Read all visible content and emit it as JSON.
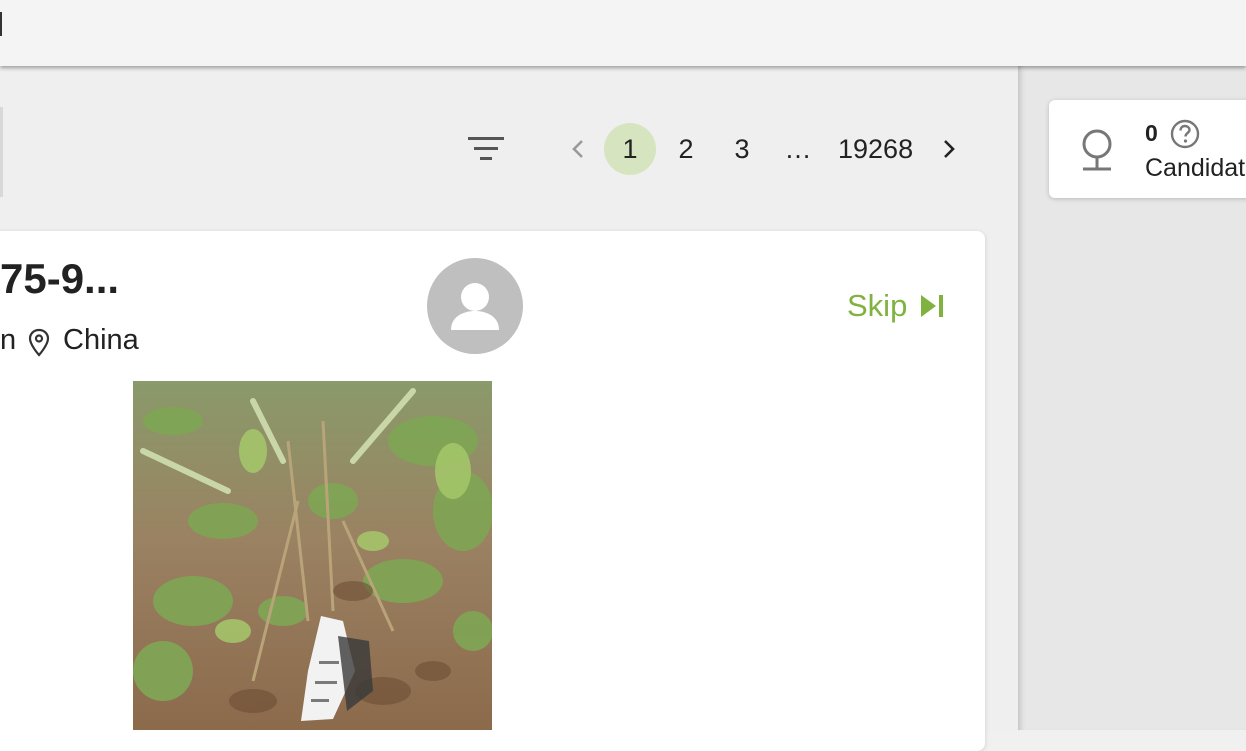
{
  "pagination": {
    "prev_icon": "chevron-left-icon",
    "next_icon": "chevron-right-icon",
    "pages": [
      "1",
      "2",
      "3",
      "…",
      "19268"
    ],
    "current": "1"
  },
  "filter": {
    "icon": "filter-icon"
  },
  "observation": {
    "title": "75-9...",
    "meta_prefix": "n",
    "location": "China",
    "skip_label": "Skip",
    "skip_icon": "skip-next-icon",
    "avatar_icon": "user-avatar-icon"
  },
  "candidates": {
    "count": "0",
    "label": "Candidate",
    "icon": "pin-marker-icon",
    "help_icon": "help-circle-icon"
  },
  "colors": {
    "accent": "#7fb23f",
    "active_page_bg": "#d6e4bf"
  }
}
